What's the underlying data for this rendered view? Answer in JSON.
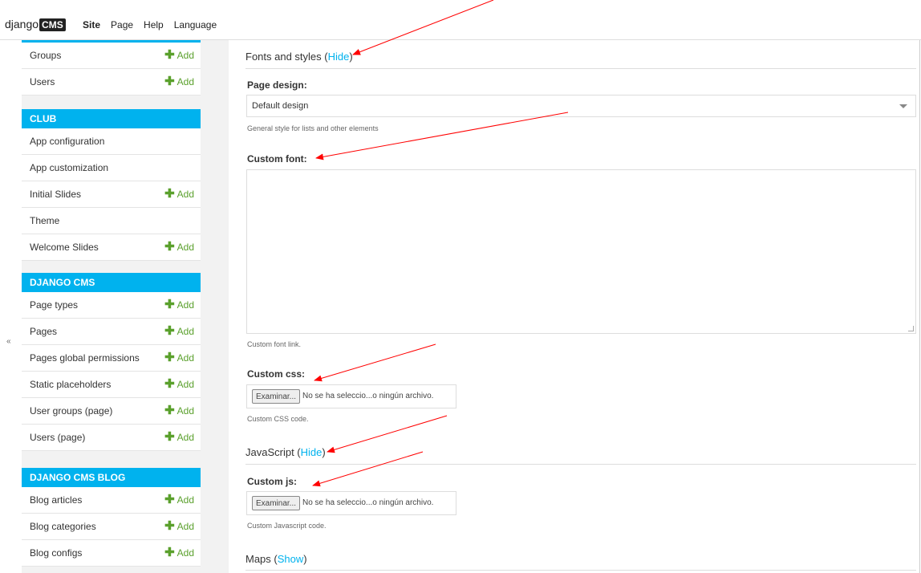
{
  "toolbar": {
    "logo_text": "django",
    "logo_badge": "CMS",
    "menu": [
      "Site",
      "Page",
      "Help",
      "Language"
    ]
  },
  "sidebar": {
    "collapse_glyph": "«",
    "top_rows": [
      {
        "label": "Groups",
        "add": "Add"
      },
      {
        "label": "Users",
        "add": "Add"
      }
    ],
    "modules": [
      {
        "title": "CLUB",
        "rows": [
          {
            "label": "App configuration",
            "add": ""
          },
          {
            "label": "App customization",
            "add": ""
          },
          {
            "label": "Initial Slides",
            "add": "Add"
          },
          {
            "label": "Theme",
            "add": ""
          },
          {
            "label": "Welcome Slides",
            "add": "Add"
          }
        ]
      },
      {
        "title": "DJANGO CMS",
        "rows": [
          {
            "label": "Page types",
            "add": "Add"
          },
          {
            "label": "Pages",
            "add": "Add"
          },
          {
            "label": "Pages global permissions",
            "add": "Add"
          },
          {
            "label": "Static placeholders",
            "add": "Add"
          },
          {
            "label": "User groups (page)",
            "add": "Add"
          },
          {
            "label": "Users (page)",
            "add": "Add"
          }
        ]
      },
      {
        "title": "DJANGO CMS BLOG",
        "rows": [
          {
            "label": "Blog articles",
            "add": "Add"
          },
          {
            "label": "Blog categories",
            "add": "Add"
          },
          {
            "label": "Blog configs",
            "add": "Add"
          }
        ]
      }
    ]
  },
  "main": {
    "fonts_section": {
      "title": "Fonts and styles (",
      "toggle": "Hide",
      "close": ")"
    },
    "page_design": {
      "label": "Page design:",
      "value": "Default design",
      "help": "General style for lists and other elements"
    },
    "custom_font": {
      "label": "Custom font:",
      "value": "",
      "help": "Custom font link."
    },
    "custom_css": {
      "label": "Custom css:",
      "button": "Examinar...",
      "status": "No se ha seleccio...o ningún archivo.",
      "help": "Custom CSS code."
    },
    "js_section": {
      "title": "JavaScript (",
      "toggle": "Hide",
      "close": ")"
    },
    "custom_js": {
      "label": "Custom js:",
      "button": "Examinar...",
      "status": "No se ha seleccio...o ningún archivo.",
      "help": "Custom Javascript code."
    },
    "maps_section": {
      "title": "Maps (",
      "toggle": "Show",
      "close": ")"
    }
  },
  "colors": {
    "accent": "#00b2ee",
    "add_green": "#5aa02c",
    "annotation_red": "#ff0000"
  }
}
